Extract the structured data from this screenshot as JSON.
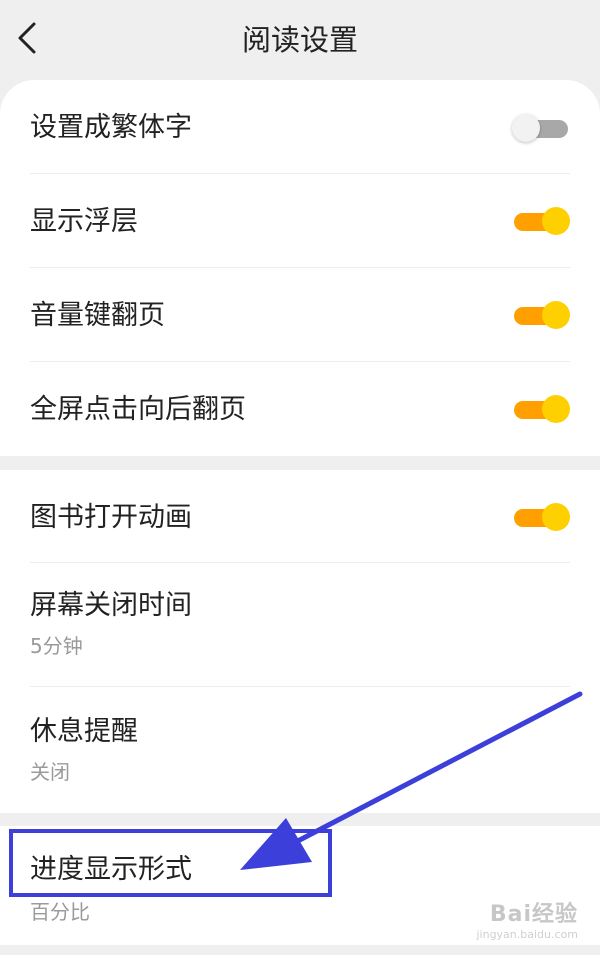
{
  "header": {
    "title": "阅读设置",
    "back_icon": "chevron-left-icon"
  },
  "colors": {
    "toggle_on_track": "#ffa000",
    "toggle_on_knob": "#ffd000",
    "toggle_off_track": "#a8a8a8",
    "highlight": "#3c3fd9"
  },
  "settings": {
    "traditional": {
      "label": "设置成繁体字",
      "enabled": false
    },
    "overlay": {
      "label": "显示浮层",
      "enabled": true
    },
    "volume_keys": {
      "label": "音量键翻页",
      "enabled": true
    },
    "fullscreen_tap": {
      "label": "全屏点击向后翻页",
      "enabled": true
    },
    "open_animation": {
      "label": "图书打开动画",
      "enabled": true
    },
    "screen_timeout": {
      "label": "屏幕关闭时间",
      "value": "5分钟"
    },
    "rest_reminder": {
      "label": "休息提醒",
      "value": "关闭"
    },
    "progress_format": {
      "label": "进度显示形式",
      "value": "百分比"
    }
  },
  "watermark": {
    "logo": "Bai经验",
    "url": "jingyan.baidu.com"
  }
}
